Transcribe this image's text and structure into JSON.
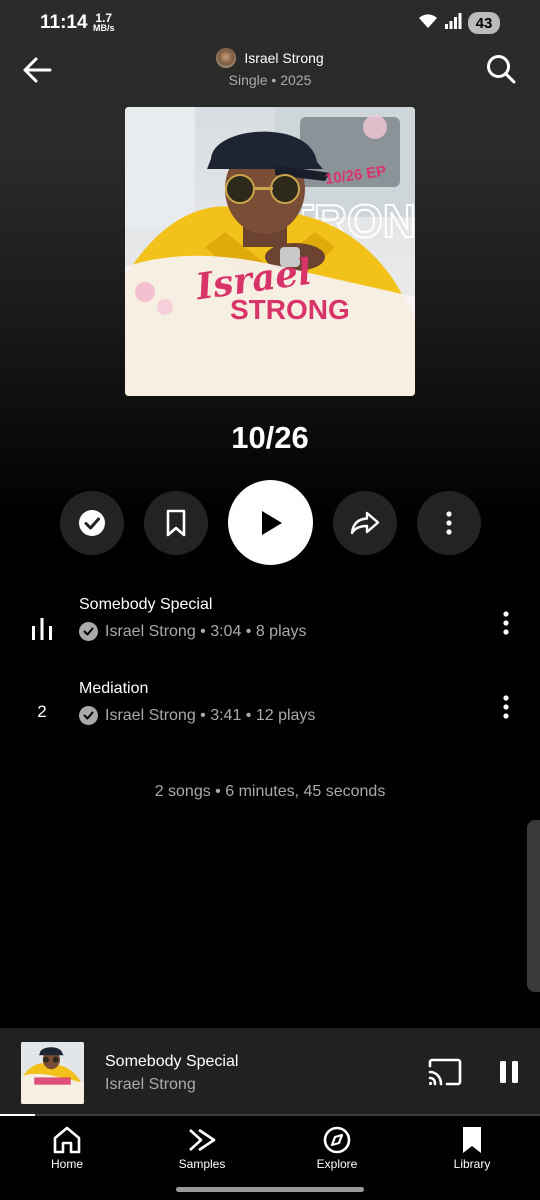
{
  "status_bar": {
    "time": "11:14",
    "net_speed_value": "1.7",
    "net_speed_unit": "MB/s",
    "battery": "43"
  },
  "header": {
    "artist": "Israel Strong",
    "subtitle": "Single • 2025",
    "back_icon": "arrow-left-icon",
    "search_icon": "search-icon"
  },
  "album": {
    "title": "10/26",
    "art_text_ep": "10/26 EP",
    "art_text_script": "Israel",
    "art_text_bold": "STRONG",
    "art_text_bg": "STRONG"
  },
  "actions": {
    "icons": [
      "check-circle-icon",
      "bookmark-icon",
      "play-icon",
      "share-icon",
      "more-vertical-icon"
    ]
  },
  "tracks": [
    {
      "index_icon": "equalizer-icon",
      "index": "",
      "title": "Somebody Special",
      "artist": "Israel Strong",
      "duration": "3:04",
      "plays": "8 plays",
      "meta": "Israel Strong • 3:04 • 8 plays",
      "now_playing": true
    },
    {
      "index_icon": "",
      "index": "2",
      "title": "Mediation",
      "artist": "Israel Strong",
      "duration": "3:41",
      "plays": "12 plays",
      "meta": "Israel Strong • 3:41 • 12 plays",
      "now_playing": false
    }
  ],
  "summary": "2 songs • 6 minutes, 45 seconds",
  "mini_player": {
    "title": "Somebody Special",
    "artist": "Israel Strong",
    "progress_fraction": 0.065,
    "cast_icon": "cast-icon",
    "pause_icon": "pause-icon"
  },
  "bottom_nav": [
    {
      "label": "Home",
      "icon": "home-icon",
      "active": false
    },
    {
      "label": "Samples",
      "icon": "samples-icon",
      "active": false
    },
    {
      "label": "Explore",
      "icon": "compass-icon",
      "active": false
    },
    {
      "label": "Library",
      "icon": "library-bookmark-icon",
      "active": true
    }
  ],
  "colors": {
    "background": "#000000",
    "mini_player_bg": "#212121",
    "secondary_text": "#aaaaaa",
    "button_bg": "#232323",
    "album_accent": "#d9346a"
  }
}
